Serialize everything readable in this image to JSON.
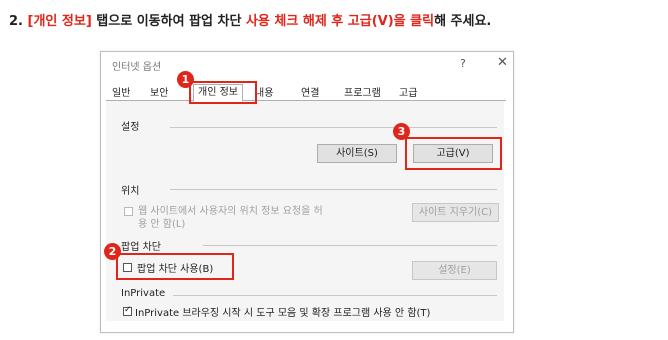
{
  "instruction": {
    "prefix": "2. ",
    "tab_name": "[개인 정보]",
    "mid": " 탭으로 이동하여 팝업 차단 ",
    "action": "사용 체크 해제 후 고급(V)을 클릭",
    "suffix": "해 주세요."
  },
  "dialog": {
    "title": "인터넷 옵션",
    "help_glyph": "?",
    "close_glyph": "✕"
  },
  "tabs": [
    "일반",
    "보안",
    "개인 정보",
    "내용",
    "연결",
    "프로그램",
    "고급"
  ],
  "sections": {
    "settings": {
      "label": "설정",
      "sites_button": "사이트(S)",
      "advanced_button": "고급(V)"
    },
    "location": {
      "label": "위치",
      "checkbox_line1": "웹 사이트에서 사용자의 위치 정보 요청을 허",
      "checkbox_line2": "용 안 함(L)",
      "checkbox_checked": false,
      "clear_sites_button": "사이트 지우기(C)"
    },
    "popup_blocker": {
      "label": "팝업 차단",
      "checkbox_label": "팝업 차단 사용(B)",
      "checkbox_checked": false,
      "settings_button": "설정(E)"
    },
    "inprivate": {
      "label": "InPrivate",
      "checkbox_label": "InPrivate 브라우징 시작 시 도구 모음 및 확장 프로그램 사용 안 함(T)",
      "checkbox_checked": true
    }
  },
  "badges": {
    "step1": "1",
    "step2": "2",
    "step3": "3"
  },
  "colors": {
    "highlight": "#e0261b"
  }
}
